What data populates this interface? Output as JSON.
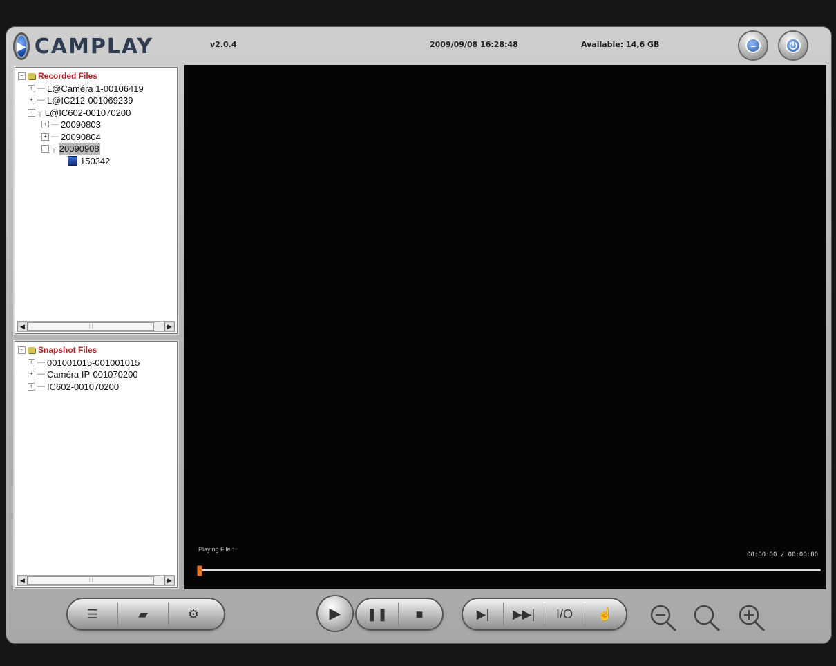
{
  "app": {
    "brand": "CAMPLAY",
    "version": "v2.0.4",
    "datetime": "2009/09/08 16:28:48",
    "available": "Available: 14,6 GB"
  },
  "recorded": {
    "root": "Recorded Files",
    "items": [
      {
        "label": "L@Caméra 1-00106419"
      },
      {
        "label": "L@IC212-001069239"
      },
      {
        "label": "L@IC602-001070200"
      },
      {
        "label": "20090803"
      },
      {
        "label": "20090804"
      },
      {
        "label": "20090908"
      },
      {
        "label": "150342"
      }
    ]
  },
  "snapshot": {
    "root": "Snapshot Files",
    "items": [
      {
        "label": "001001015-001001015"
      },
      {
        "label": "Caméra IP-001070200"
      },
      {
        "label": "IC602-001070200"
      }
    ]
  },
  "player": {
    "playing_label": "Playing File :",
    "timecode": "00:00:00 / 00:00:00",
    "progress": 0
  },
  "icons": {
    "minimize": "minimize-icon",
    "power": "power-icon",
    "list": "list-view-icon",
    "snapshot": "snapshot-icon",
    "settings": "camera-settings-icon",
    "play": "play-icon",
    "pause": "pause-icon",
    "stop": "stop-icon",
    "step": "step-forward-icon",
    "fast_forward": "fast-forward-icon",
    "io": "io-icon",
    "hand": "hand-icon",
    "zoom_out": "zoom-out-icon",
    "zoom_reset": "zoom-reset-icon",
    "zoom_in": "zoom-in-icon"
  },
  "colors": {
    "root_label": "#b0262b",
    "seek_handle": "#e2752a",
    "video_bg": "#050505"
  }
}
